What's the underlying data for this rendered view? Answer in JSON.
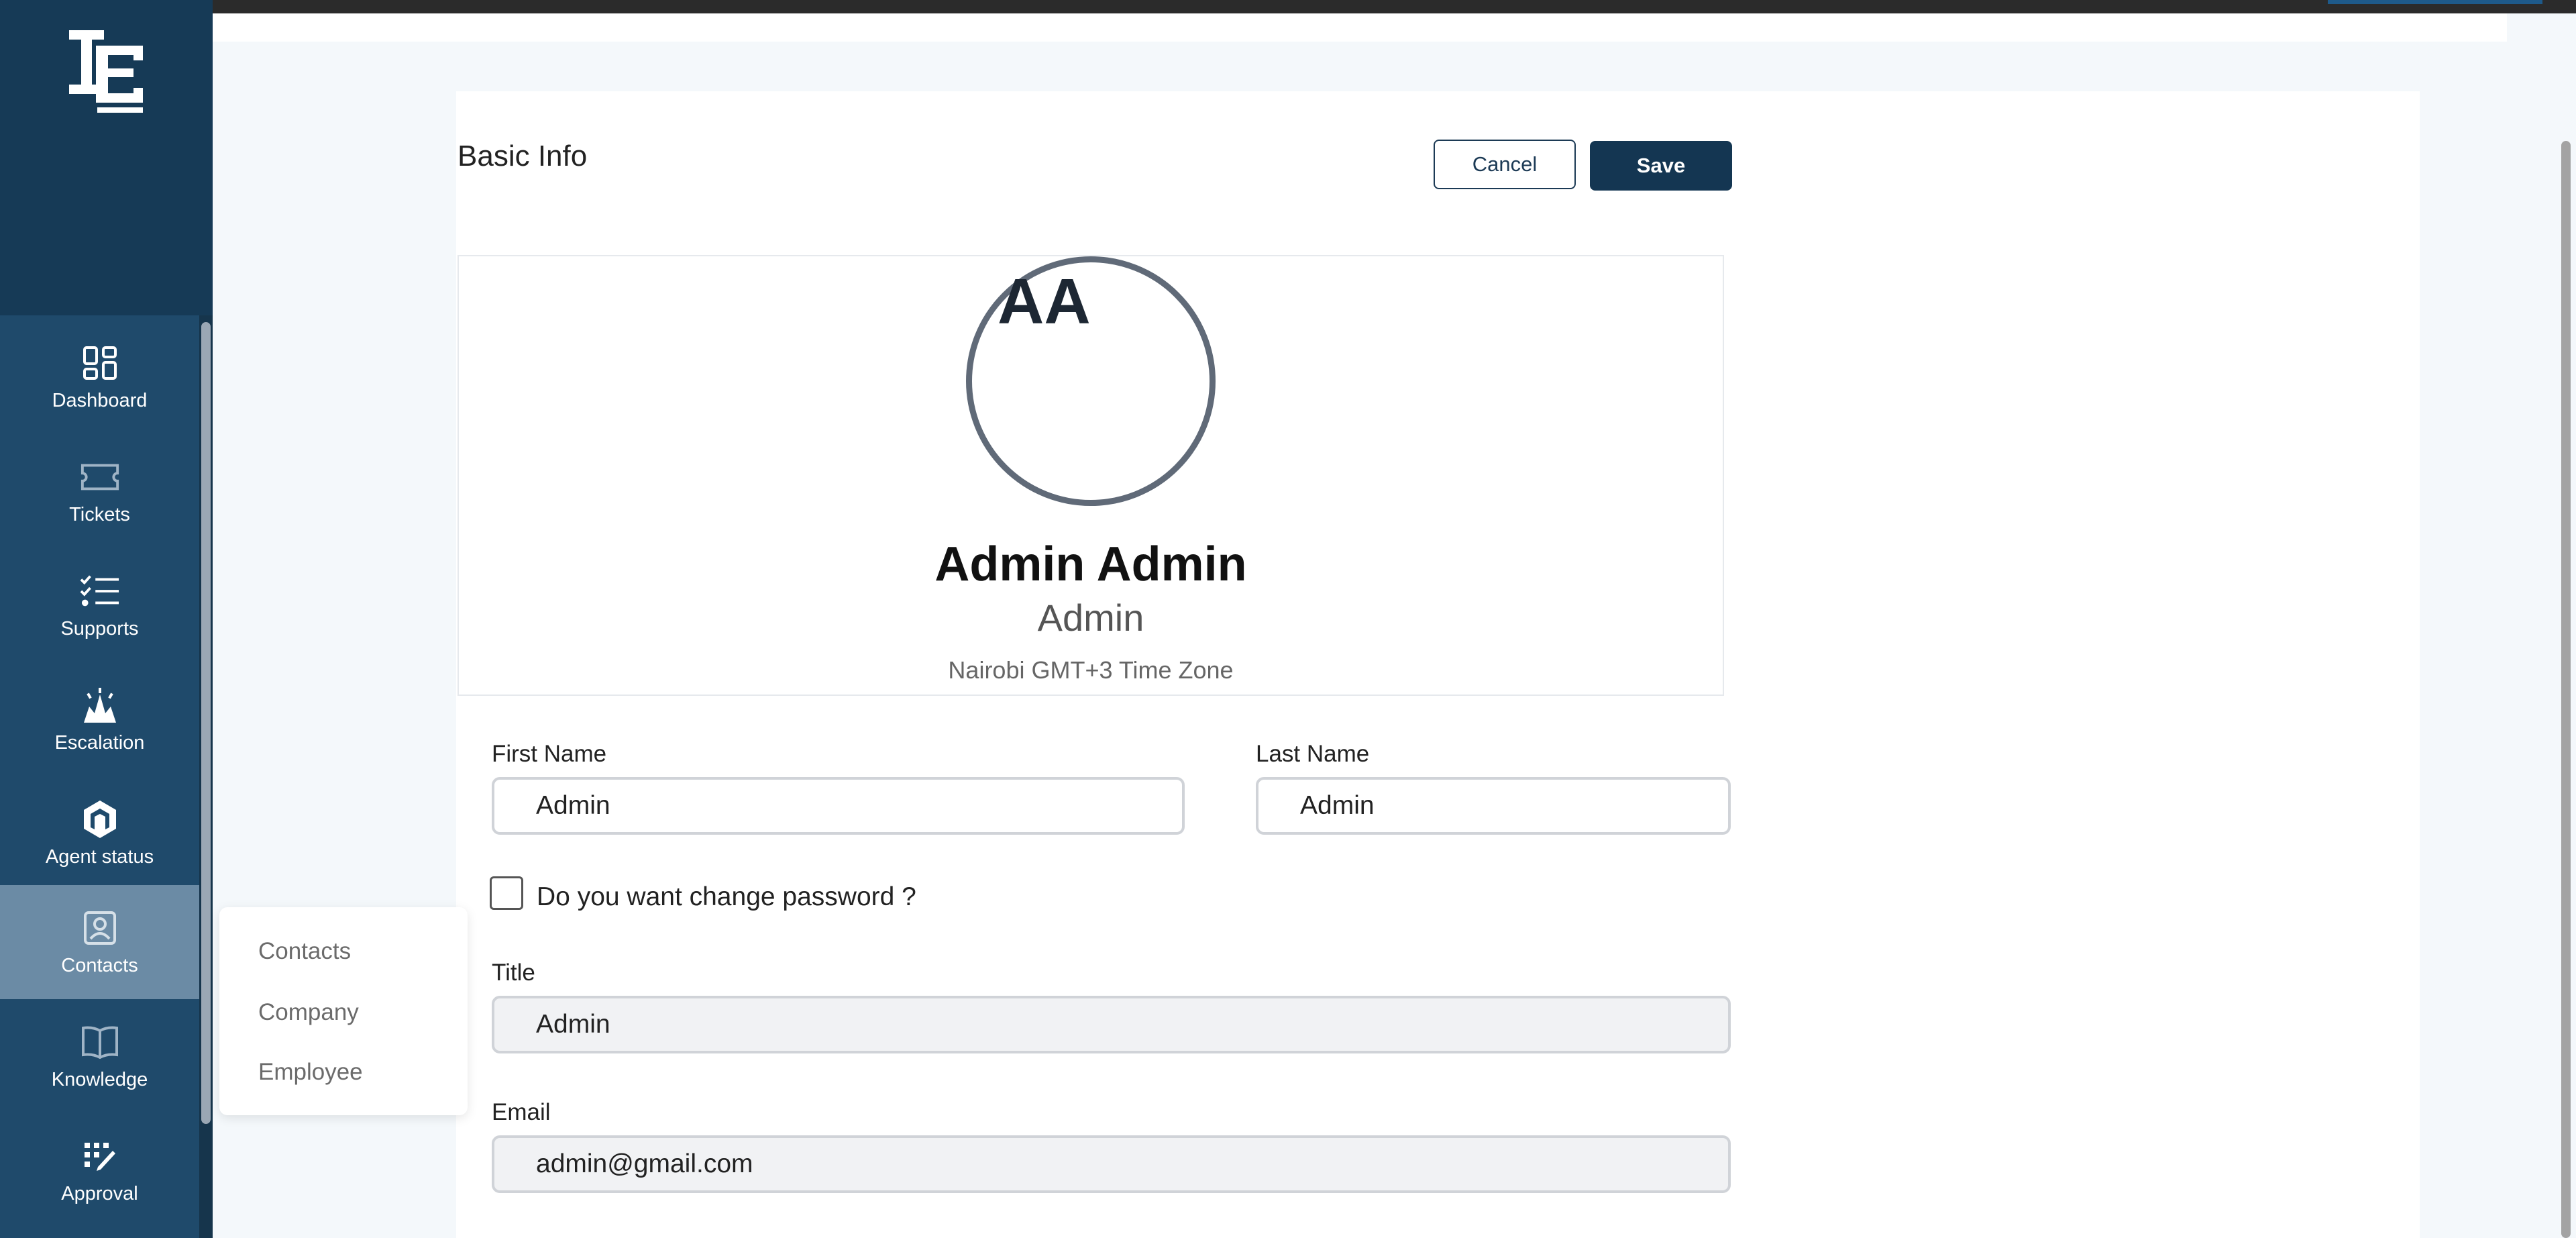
{
  "sidebar": {
    "items": [
      {
        "label": "Dashboard",
        "icon": "dashboard-grid-icon"
      },
      {
        "label": "Tickets",
        "icon": "ticket-icon"
      },
      {
        "label": "Supports",
        "icon": "checklist-icon"
      },
      {
        "label": "Escalation",
        "icon": "escalation-icon"
      },
      {
        "label": "Agent status",
        "icon": "agent-status-icon"
      },
      {
        "label": "Contacts",
        "icon": "contact-card-icon",
        "active": true
      },
      {
        "label": "Knowledge",
        "icon": "book-icon"
      },
      {
        "label": "Approval",
        "icon": "approval-icon"
      }
    ],
    "submenu": [
      "Contacts",
      "Company",
      "Employee"
    ]
  },
  "header": {
    "title": "Basic Info",
    "cancel_label": "Cancel",
    "save_label": "Save"
  },
  "profile": {
    "initials": "AA",
    "name": "Admin Admin",
    "role": "Admin",
    "timezone": "Nairobi GMT+3 Time Zone"
  },
  "form": {
    "first_name": {
      "label": "First Name",
      "value": "Admin"
    },
    "last_name": {
      "label": "Last Name",
      "value": "Admin"
    },
    "change_password": {
      "label": "Do you want change password ?",
      "checked": false
    },
    "title": {
      "label": "Title",
      "value": "Admin"
    },
    "email": {
      "label": "Email",
      "value": "admin@gmail.com"
    }
  },
  "colors": {
    "sidebar": "#1f4a6b",
    "sidebar_top": "#163a56",
    "active_nav": "#6b8ba5",
    "primary_button": "#143652"
  }
}
